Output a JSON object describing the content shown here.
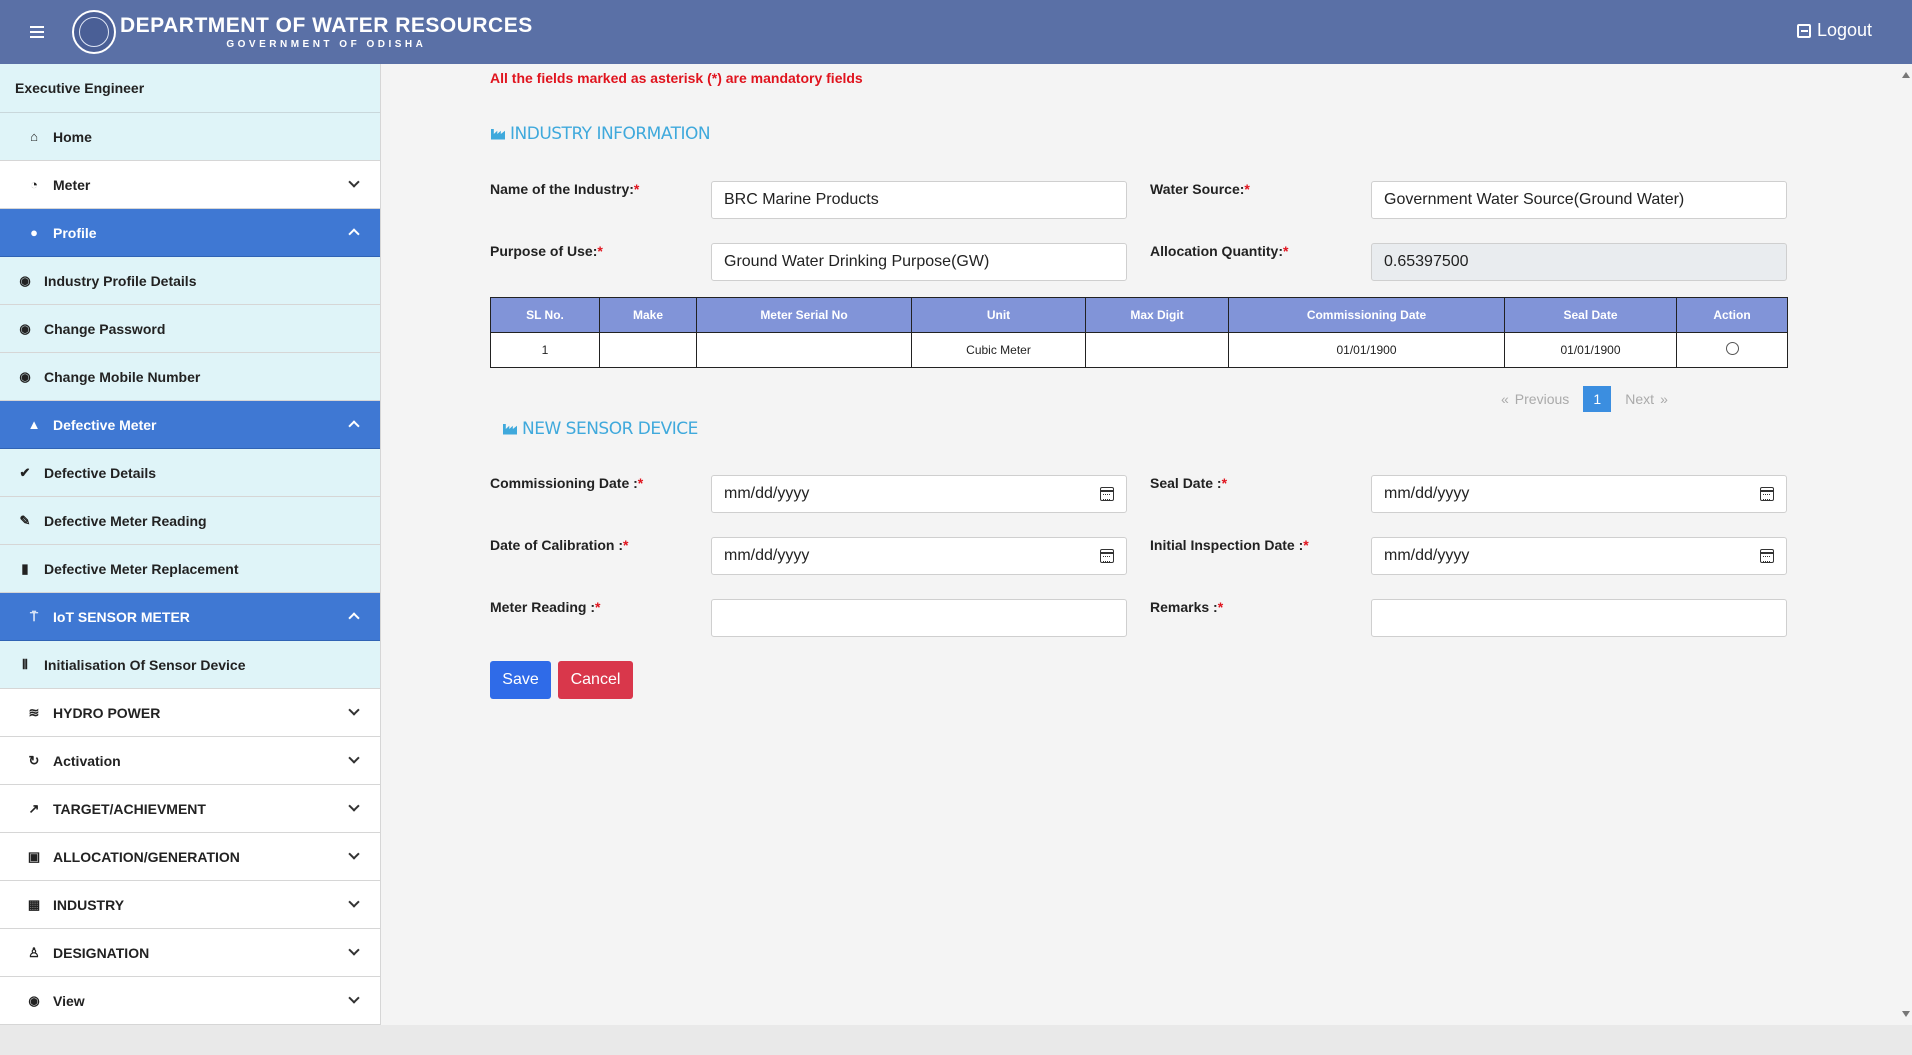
{
  "header": {
    "title": "DEPARTMENT OF WATER RESOURCES",
    "subtitle": "GOVERNMENT OF ODISHA",
    "logout_label": "Logout"
  },
  "sidebar": {
    "role": "Executive Engineer",
    "items": [
      {
        "label": "Home",
        "icon": "home-icon"
      },
      {
        "label": "Meter",
        "icon": "gauge-icon"
      },
      {
        "label": "Profile",
        "icon": "user-icon"
      },
      {
        "label": "Industry Profile Details",
        "icon": "account-circle-icon"
      },
      {
        "label": "Change Password",
        "icon": "account-circle-icon"
      },
      {
        "label": "Change Mobile Number",
        "icon": "account-circle-icon"
      },
      {
        "label": "Defective Meter",
        "icon": "warning-icon"
      },
      {
        "label": "Defective Details",
        "icon": "check-circle-icon"
      },
      {
        "label": "Defective Meter Reading",
        "icon": "edit-note-icon"
      },
      {
        "label": "Defective Meter Replacement",
        "icon": "table-icon"
      },
      {
        "label": "IoT SENSOR METER",
        "icon": "sensor-icon"
      },
      {
        "label": "Initialisation Of Sensor Device",
        "icon": "waveform-icon"
      },
      {
        "label": "HYDRO POWER",
        "icon": "waves-icon"
      },
      {
        "label": "Activation",
        "icon": "refresh-icon"
      },
      {
        "label": "TARGET/ACHIEVMENT",
        "icon": "trend-icon"
      },
      {
        "label": "ALLOCATION/GENERATION",
        "icon": "document-search-icon"
      },
      {
        "label": "INDUSTRY",
        "icon": "building-icon"
      },
      {
        "label": "DESIGNATION",
        "icon": "person-icon"
      },
      {
        "label": "View",
        "icon": "eye-icon"
      }
    ]
  },
  "form": {
    "mandatory_note": "All the fields marked as asterisk (*) are mandatory fields",
    "industry_section_title": "INDUSTRY INFORMATION",
    "sensor_section_title": "NEW SENSOR DEVICE",
    "required_mark": "*",
    "industry_name_label": "Name of the Industry:",
    "industry_name_value": "BRC Marine Products",
    "water_source_label": "Water Source:",
    "water_source_value": "Government Water Source(Ground Water)",
    "purpose_label": "Purpose of Use:",
    "purpose_value": "Ground Water Drinking Purpose(GW)",
    "allocation_label": "Allocation Quantity:",
    "allocation_value": "0.65397500",
    "commissioning_label": "Commissioning Date :",
    "seal_label": "Seal Date :",
    "calibration_label": "Date of Calibration :",
    "inspection_label": "Initial Inspection Date :",
    "meter_reading_label": "Meter Reading :",
    "remarks_label": "Remarks :",
    "date_placeholder": "mm/dd/yyyy",
    "meter_reading_value": "",
    "remarks_value": "",
    "save_label": "Save",
    "cancel_label": "Cancel"
  },
  "table": {
    "headers": [
      "SL No.",
      "Make",
      "Meter Serial No",
      "Unit",
      "Max Digit",
      "Commissioning Date",
      "Seal Date",
      "Action"
    ],
    "rows": [
      [
        "1",
        "",
        "",
        "Cubic Meter",
        "",
        "01/01/1900",
        "01/01/1900"
      ]
    ]
  },
  "pagination": {
    "prev_label": "Previous",
    "next_label": "Next",
    "current_page": "1",
    "prev_arrow": "«",
    "next_arrow": "»"
  }
}
